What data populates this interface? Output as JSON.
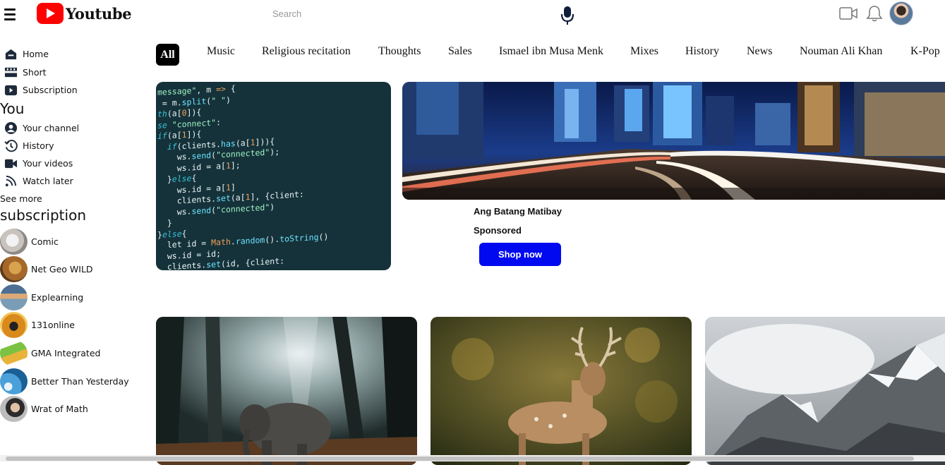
{
  "header": {
    "logo_text": "Youtube",
    "search_placeholder": "Search"
  },
  "sidebar": {
    "main": [
      {
        "label": "Home",
        "icon": "home-icon"
      },
      {
        "label": "Short",
        "icon": "shorts-icon"
      },
      {
        "label": "Subscription",
        "icon": "subscription-icon"
      }
    ],
    "you_heading": "You",
    "you_items": [
      {
        "label": "Your channel",
        "icon": "user-circle-icon"
      },
      {
        "label": "History",
        "icon": "history-icon"
      },
      {
        "label": "Your videos",
        "icon": "video-camera-icon"
      },
      {
        "label": "Watch later",
        "icon": "watch-later-icon"
      }
    ],
    "see_more": "See more",
    "subscription_heading": "subscription",
    "subscriptions": [
      {
        "label": "Comic"
      },
      {
        "label": "Net Geo WILD"
      },
      {
        "label": "Explearning"
      },
      {
        "label": "131online"
      },
      {
        "label": "GMA Integrated"
      },
      {
        "label": "Better Than Yesterday"
      },
      {
        "label": "Wrat of Math"
      }
    ]
  },
  "chips": [
    "All",
    "Music",
    "Religious recitation",
    "Thoughts",
    "Sales",
    "Ismael ibn Musa Menk",
    "Mixes",
    "History",
    "News",
    "Nouman Ali Khan",
    "K-Pop"
  ],
  "ad": {
    "title": "Ang Batang Matibay",
    "sponsored": "Sponsored",
    "button": "Shop now"
  },
  "colors": {
    "brand_red": "#ff0000",
    "shop_button": "#0009f0"
  }
}
